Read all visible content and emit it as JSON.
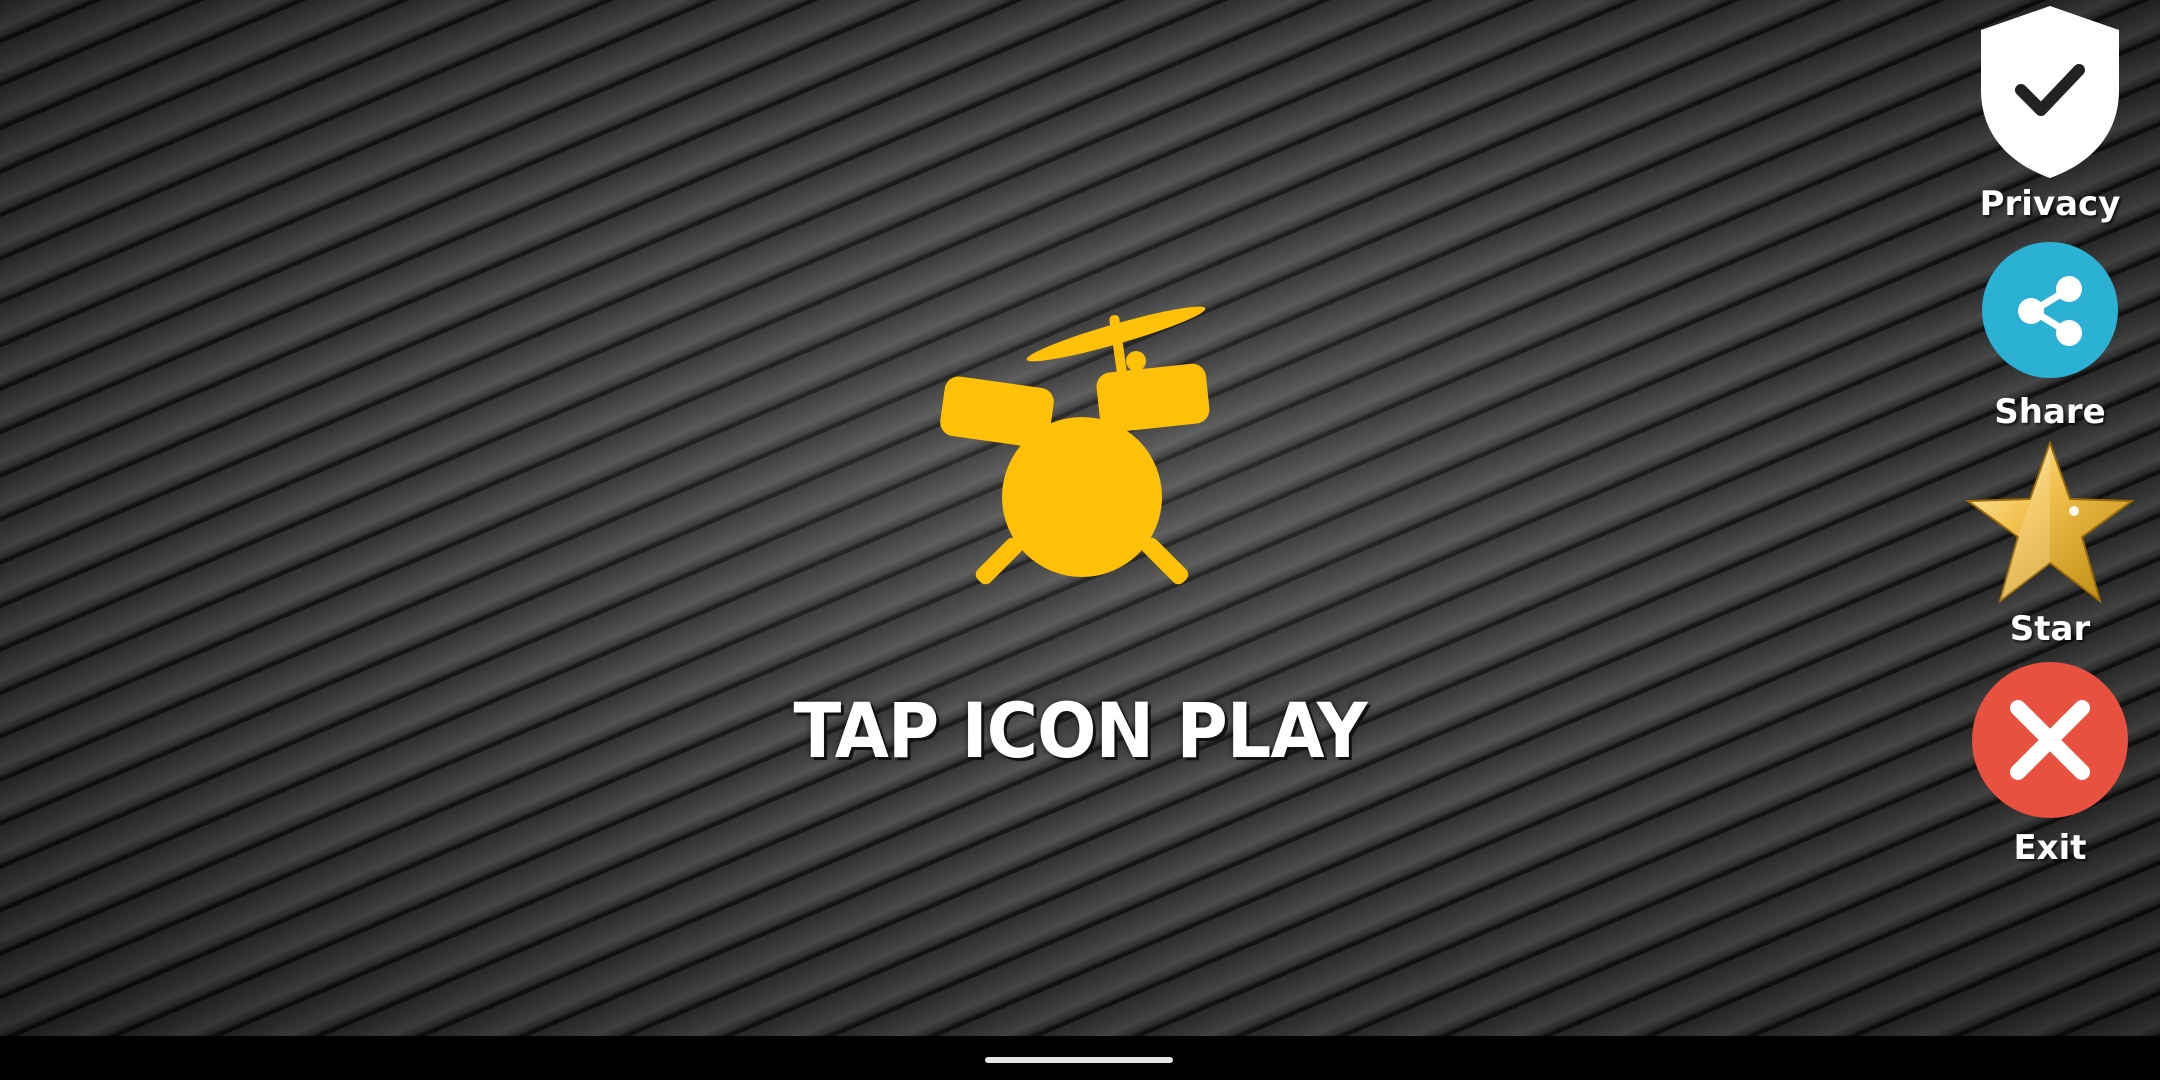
{
  "main": {
    "play_hint": "TAP ICON PLAY",
    "play_icon": "drum-kit-icon"
  },
  "side_menu": {
    "privacy": {
      "label": "Privacy",
      "icon": "shield-check-icon"
    },
    "share": {
      "label": "Share",
      "icon": "share-icon"
    },
    "star": {
      "label": "Star",
      "icon": "star-icon"
    },
    "exit": {
      "label": "Exit",
      "icon": "close-icon"
    }
  },
  "colors": {
    "accent": "#ffc107",
    "share": "#2bb1d3",
    "exit": "#e8503f",
    "star": "#f2c14e"
  }
}
